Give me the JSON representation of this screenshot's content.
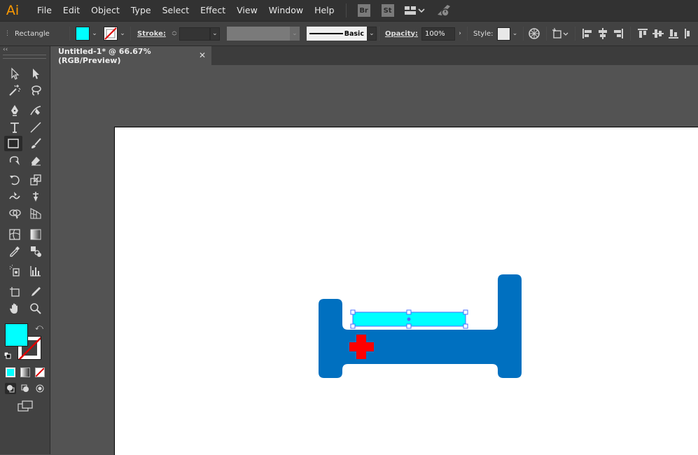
{
  "app": {
    "logo": "Ai"
  },
  "menu": {
    "items": [
      "File",
      "Edit",
      "Object",
      "Type",
      "Select",
      "Effect",
      "View",
      "Window",
      "Help"
    ],
    "bridge": "Br",
    "stock": "St"
  },
  "control_bar": {
    "tool_name": "Rectangle",
    "fill_color": "#00ffff",
    "stroke_label": "Stroke:",
    "brush_label": "Basic",
    "opacity_label": "Opacity:",
    "opacity_value": "100%",
    "style_label": "Style:"
  },
  "document_tab": {
    "title": "Untitled-1* @ 66.67% (RGB/Preview)"
  },
  "tools": {
    "fill_color": "#00ffff",
    "stroke": "none"
  },
  "artwork": {
    "bed_color": "#0070c0",
    "pillow_color": "#00ffff",
    "cross_color": "#ff0000",
    "selection_color": "#4a6cff"
  }
}
